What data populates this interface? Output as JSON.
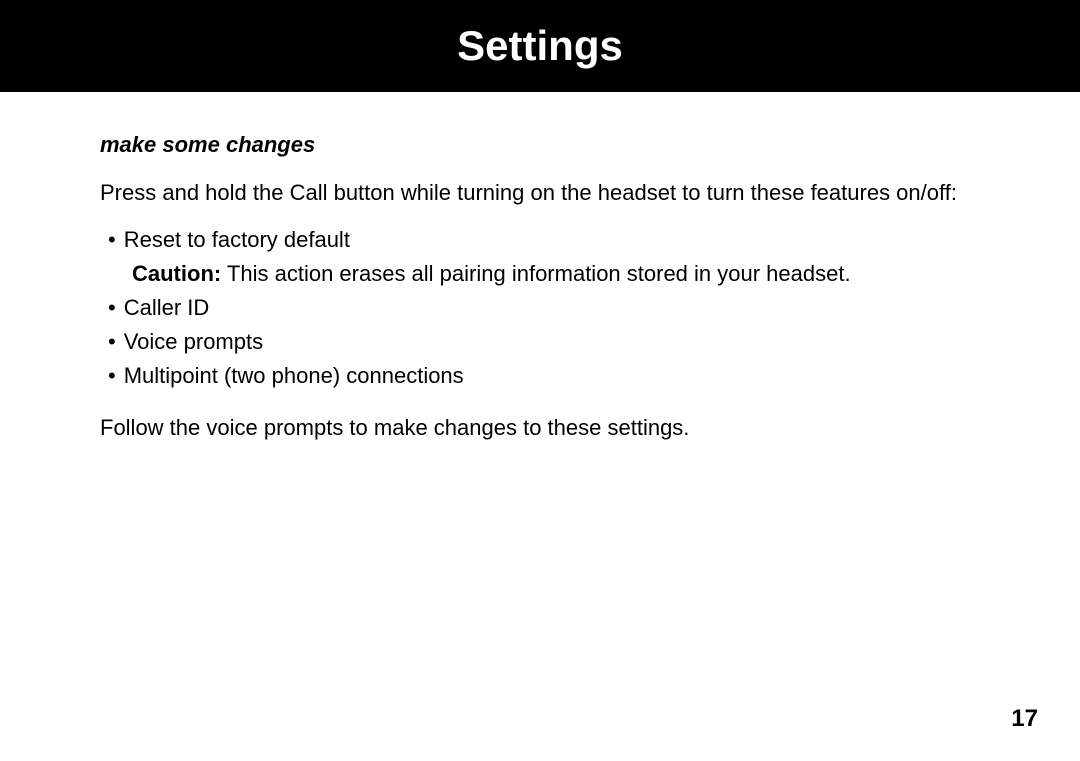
{
  "header": {
    "title": "Settings"
  },
  "subtitle": "make some changes",
  "intro": "Press and hold the Call button while turning on the headset to turn these features on/off:",
  "bullets": [
    {
      "text": "Reset to factory default",
      "caution_label": "Caution:",
      "caution_text": " This action erases all pairing information stored in your headset."
    },
    {
      "text": "Caller ID"
    },
    {
      "text": "Voice prompts"
    },
    {
      "text": "Multipoint (two phone) connections"
    }
  ],
  "closing": "Follow the voice prompts to make changes to these settings.",
  "page_number": "17",
  "bullet_char": "•"
}
